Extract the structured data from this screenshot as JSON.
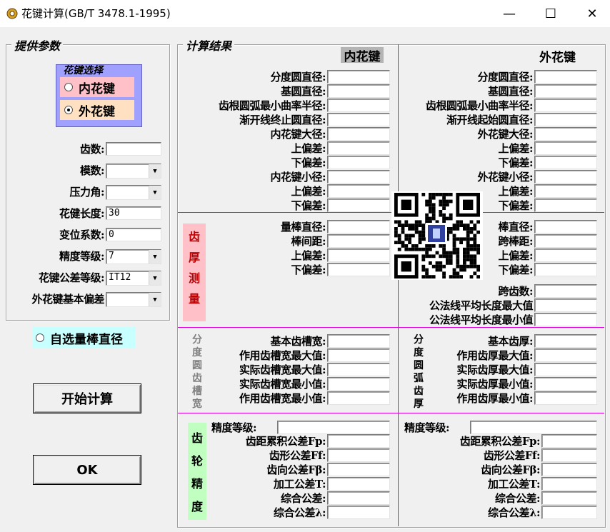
{
  "window": {
    "title": "花键计算(GB/T 3478.1-1995)",
    "minimize": "—",
    "maximize": "☐",
    "close": "✕"
  },
  "params": {
    "legend": "提供参数",
    "spline_select": {
      "legend": "花键选择",
      "inner": "内花键",
      "outer": "外花键",
      "selected": "outer"
    },
    "fields": [
      {
        "label": "齿数:",
        "value": "",
        "type": "text"
      },
      {
        "label": "模数:",
        "value": "",
        "type": "combo"
      },
      {
        "label": "压力角:",
        "value": "",
        "type": "combo"
      },
      {
        "label": "花健长度:",
        "value": "30",
        "type": "text"
      },
      {
        "label": "变位系数:",
        "value": "0",
        "type": "text"
      },
      {
        "label": "精度等级:",
        "value": "7",
        "type": "combo"
      },
      {
        "label": "花键公差等级:",
        "value": "IT12",
        "type": "combo"
      },
      {
        "label": "外花键基本偏差",
        "value": "",
        "type": "combo"
      }
    ]
  },
  "custom_rod": {
    "label": "自选量棒直径"
  },
  "buttons": {
    "calc": "开始计算",
    "ok": "OK"
  },
  "results": {
    "legend": "计算结果",
    "inner_header": "内花键",
    "outer_header": "外花键",
    "inner_rows": [
      "分度圆直径:",
      "基圆直径:",
      "齿根圆弧最小曲率半径:",
      "渐开线终止圆直径:",
      "内花键大径:",
      "上偏差:",
      "下偏差:",
      "内花键小径:",
      "上偏差:",
      "下偏差:"
    ],
    "outer_rows": [
      "分度圆直径:",
      "基圆直径:",
      "齿根圆弧最小曲率半径:",
      "渐开线起始圆直径:",
      "外花键大径:",
      "上偏差:",
      "下偏差:",
      "外花键小径:",
      "上偏差:",
      "下偏差:"
    ],
    "thickness": {
      "side_label": [
        "齿",
        "厚",
        "测",
        "量"
      ],
      "inner_rows": [
        "量棒直径:",
        "棒间距:",
        "上偏差:",
        "下偏差:"
      ],
      "outer_rows": [
        "棒直径:",
        "跨棒距:",
        "上偏差:",
        "下偏差:"
      ],
      "span_rows": [
        "跨齿数:",
        "公法线平均长度最大值",
        "公法线平均长度最小值"
      ]
    },
    "slot": {
      "inner_side": [
        "分",
        "度",
        "圆",
        "齿",
        "槽",
        "宽"
      ],
      "inner_rows": [
        "基本齿槽宽:",
        "作用齿槽宽最大值:",
        "实际齿槽宽最大值:",
        "实际齿槽宽最小值:",
        "作用齿槽宽最小值:"
      ],
      "outer_side": [
        "分",
        "度",
        "圆",
        "弧",
        "齿",
        "厚"
      ],
      "outer_rows": [
        "基本齿厚:",
        "作用齿厚最大值:",
        "实际齿厚最大值:",
        "实际齿厚最小值:",
        "作用齿厚最小值:"
      ]
    },
    "precision": {
      "side_label": [
        "齿",
        "轮",
        "精",
        "度"
      ],
      "inner_grade": "精度等级:",
      "outer_grade": "精度等级:",
      "rows": [
        "齿距累积公差Fp:",
        "齿形公差Ff:",
        "齿向公差Fβ:",
        "加工公差T:",
        "综合公差:",
        "综合公差λ:"
      ]
    }
  },
  "colors": {
    "pink": "#ffc0c8",
    "peach": "#ffe0c0",
    "lavender": "#a0a0ff",
    "green": "#c0ffc0",
    "cyan": "#c8ffff",
    "magenta": "#e000e0"
  },
  "icons": {
    "app": "app-icon",
    "qr": "qr-code-image"
  }
}
